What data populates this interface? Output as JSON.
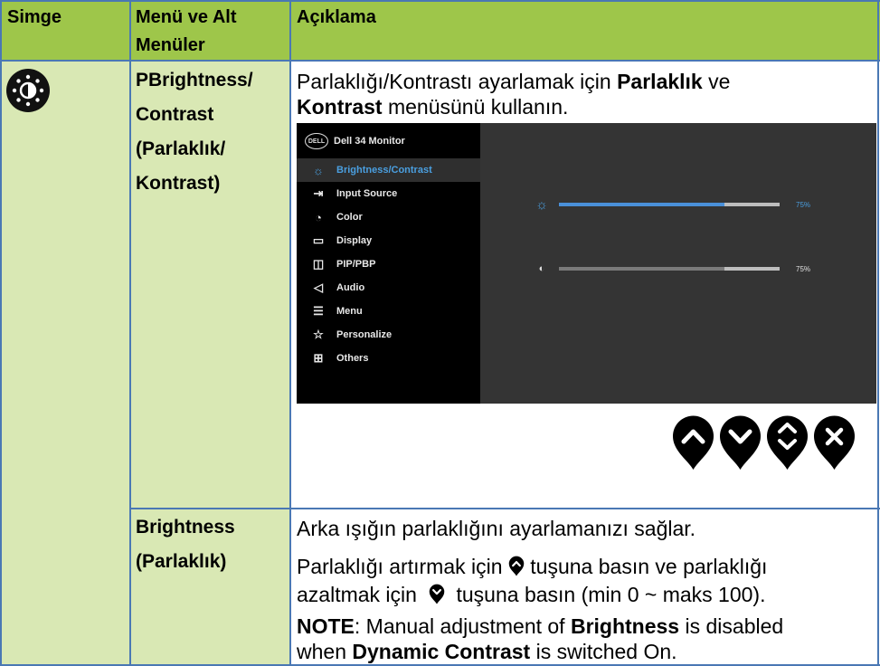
{
  "headers": {
    "col1": "Simge",
    "col2_line1": "Menü ve Alt",
    "col2_line2": "Menüler",
    "col3": "Açıklama"
  },
  "row1": {
    "menu_lines": [
      "PBrightness/",
      "Contrast",
      "(Parlaklık/",
      "Kontrast)"
    ],
    "desc_part1": "Parlaklığı/Kontrastı ayarlamak için ",
    "desc_bold1": "Parlaklık",
    "desc_part2": " ve",
    "desc_bold2": "Kontrast",
    "desc_part3": " menüsünü kullanın."
  },
  "osd": {
    "logo": "DELL",
    "title": "Dell 34 Monitor",
    "items": [
      {
        "label": "Brightness/Contrast",
        "icon": "sun-icon",
        "glyph": "☼"
      },
      {
        "label": "Input Source",
        "icon": "input-icon",
        "glyph": "⇥"
      },
      {
        "label": "Color",
        "icon": "palette-icon",
        "glyph": "◔"
      },
      {
        "label": "Display",
        "icon": "display-icon",
        "glyph": "▭"
      },
      {
        "label": "PIP/PBP",
        "icon": "pip-icon",
        "glyph": "◫"
      },
      {
        "label": "Audio",
        "icon": "speaker-icon",
        "glyph": "◁"
      },
      {
        "label": "Menu",
        "icon": "menu-icon",
        "glyph": "☰"
      },
      {
        "label": "Personalize",
        "icon": "star-icon",
        "glyph": "☆"
      },
      {
        "label": "Others",
        "icon": "others-icon",
        "glyph": "⊞"
      }
    ],
    "brightness_pct": "75%",
    "contrast_pct": "75%",
    "brightness_value": 75,
    "contrast_value": 75,
    "colors": {
      "active": "#4a9fe0",
      "bar_fill_brightness": "#4a90d9",
      "bar_fill_contrast": "#7a7a7a"
    }
  },
  "row2": {
    "menu_lines": [
      "Brightness",
      "(Parlaklık)"
    ],
    "line1": "Arka ışığın parlaklığını ayarlamanızı sağlar.",
    "line2a": "Parlaklığı artırmak için ",
    "line2b": " tuşuna basın ve parlaklığı",
    "line3a": "azaltmak için ",
    "line3b": " tuşuna basın (min 0 ~ maks 100).",
    "note_bold": "NOTE",
    "note1": ": Manual adjustment of ",
    "note_bold2": "Brightness",
    "note2": " is disabled",
    "note3": "when ",
    "note_bold3": "Dynamic Contrast",
    "note4": " is switched On."
  },
  "colors": {
    "header": "#9ec64a",
    "body_green": "#d9e8b4",
    "grid": "#4a78b4"
  }
}
